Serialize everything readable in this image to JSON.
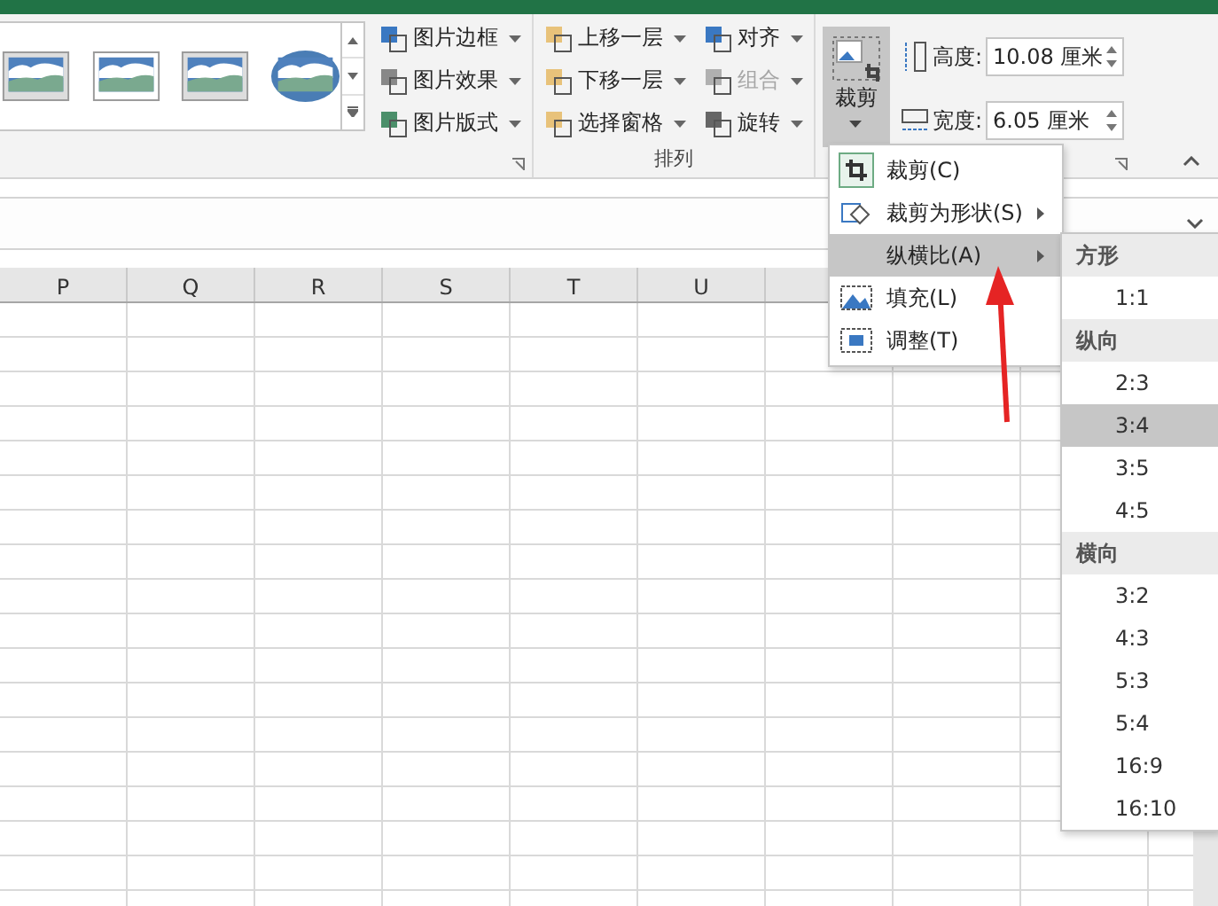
{
  "ribbon": {
    "style_commands": [
      {
        "label": "图片边框",
        "kind": "border"
      },
      {
        "label": "图片效果",
        "kind": "effect"
      },
      {
        "label": "图片版式",
        "kind": "layout"
      }
    ],
    "arrange": {
      "label": "排列",
      "commands": [
        {
          "label": "上移一层",
          "kind": "forward",
          "disabled": false
        },
        {
          "label": "对齐",
          "kind": "align",
          "disabled": false
        },
        {
          "label": "下移一层",
          "kind": "backward",
          "disabled": false
        },
        {
          "label": "组合",
          "kind": "group",
          "disabled": true
        },
        {
          "label": "选择窗格",
          "kind": "pane",
          "disabled": false
        },
        {
          "label": "旋转",
          "kind": "rotate",
          "disabled": false
        }
      ]
    },
    "crop_button": {
      "label": "裁剪",
      "expanded": true
    },
    "size": [
      {
        "label": "高度:",
        "value": "10.08 厘米",
        "kind": "height"
      },
      {
        "label": "宽度:",
        "value": "6.05 厘米",
        "kind": "width"
      }
    ]
  },
  "columns": [
    "P",
    "Q",
    "R",
    "S",
    "T",
    "U"
  ],
  "crop_menu": [
    {
      "label": "裁剪(C)",
      "kind": "crop",
      "selected": false,
      "submenu": false
    },
    {
      "label": "裁剪为形状(S)",
      "kind": "shape",
      "selected": false,
      "submenu": true
    },
    {
      "label": "纵横比(A)",
      "kind": "ratio",
      "selected": true,
      "submenu": true
    },
    {
      "label": "填充(L)",
      "kind": "fill",
      "selected": false,
      "submenu": false
    },
    {
      "label": "调整(T)",
      "kind": "fit",
      "selected": false,
      "submenu": false
    }
  ],
  "aspect_menu": [
    {
      "header": "方形",
      "items": [
        {
          "label": "1:1",
          "selected": false
        }
      ]
    },
    {
      "header": "纵向",
      "items": [
        {
          "label": "2:3",
          "selected": false
        },
        {
          "label": "3:4",
          "selected": true
        },
        {
          "label": "3:5",
          "selected": false
        },
        {
          "label": "4:5",
          "selected": false
        }
      ]
    },
    {
      "header": "横向",
      "items": [
        {
          "label": "3:2",
          "selected": false
        },
        {
          "label": "4:3",
          "selected": false
        },
        {
          "label": "5:3",
          "selected": false
        },
        {
          "label": "5:4",
          "selected": false
        },
        {
          "label": "16:9",
          "selected": false
        },
        {
          "label": "16:10",
          "selected": false
        }
      ]
    }
  ]
}
